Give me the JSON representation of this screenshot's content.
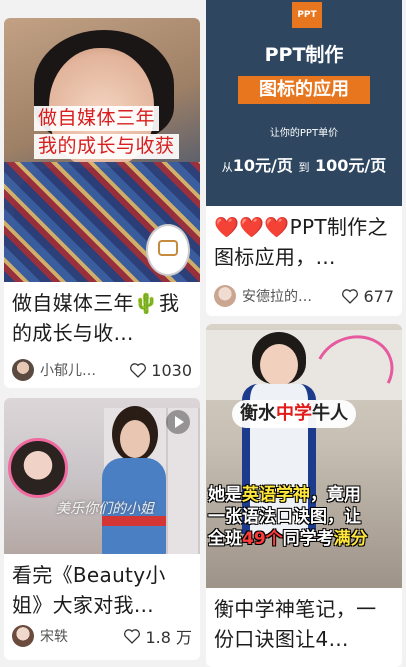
{
  "feed": {
    "left": [
      {
        "cover": {
          "line1": "做自媒体三年",
          "line2": "我的成长与收获"
        },
        "title": "做自媒体三年🌵我的成长与收…",
        "author": "小郁儿…",
        "likes": "1030"
      },
      {
        "cover": {
          "caption": "美乐你们的小姐"
        },
        "title": "看完《Beauty小姐》大家对我…",
        "author": "宋轶",
        "likes": "1.8 万"
      }
    ],
    "right": [
      {
        "cover": {
          "logo": "PPT",
          "heading": "PPT制作",
          "banner": "图标的应用",
          "sub": "让你的PPT单价",
          "price_from": "从",
          "price_a": "10元/页",
          "price_to": "到",
          "price_b": "100元/页"
        },
        "title": "❤️❤️❤️PPT制作之图标应用，…",
        "author": "安德拉的…",
        "likes": "677"
      },
      {
        "cover": {
          "pill_a": "衡水",
          "pill_b": "中学",
          "pill_c": "牛人",
          "l1a": "她是",
          "l1b": "英语学神",
          "l1c": "，竟用",
          "l2": "一张语法口诀图，让",
          "l3a": "全班",
          "l3b": "49个",
          "l3c": "同学考",
          "l3d": "满分"
        },
        "title": "衡中学神笔记，一份口诀图让4…"
      }
    ]
  },
  "colors": {
    "accent_red": "#d81e1e",
    "ppt_orange": "#e8761e",
    "ppt_navy": "#2e4660"
  },
  "icons": {
    "like": "heart-outline-icon",
    "video": "play-icon"
  }
}
